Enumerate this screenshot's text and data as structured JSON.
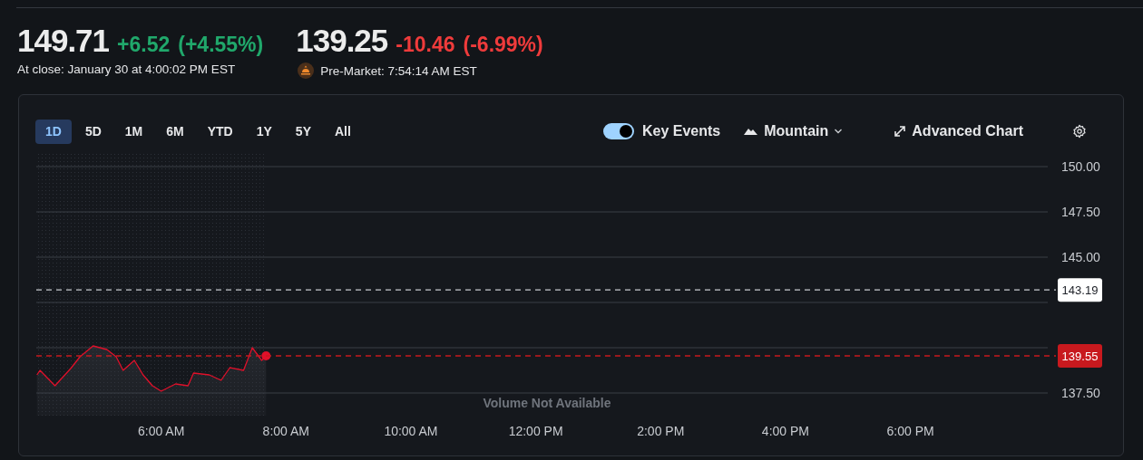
{
  "quote": {
    "price": "149.71",
    "change": "+6.52",
    "change_percent": "(+4.55%)",
    "close_label": "At close: January 30 at 4:00:02 PM EST"
  },
  "premarket": {
    "price": "139.25",
    "change": "-10.46",
    "change_percent": "(-6.99%)",
    "time_label": "Pre-Market: 7:54:14 AM EST"
  },
  "ranges": [
    {
      "label": "1D",
      "selected": true
    },
    {
      "label": "5D",
      "selected": false
    },
    {
      "label": "1M",
      "selected": false
    },
    {
      "label": "6M",
      "selected": false
    },
    {
      "label": "YTD",
      "selected": false
    },
    {
      "label": "1Y",
      "selected": false
    },
    {
      "label": "5Y",
      "selected": false
    },
    {
      "label": "All",
      "selected": false
    }
  ],
  "key_events": {
    "label": "Key Events",
    "on": true
  },
  "chart_type": {
    "label": "Mountain"
  },
  "advanced_chart": {
    "label": "Advanced Chart"
  },
  "volume_note": "Volume Not Available",
  "chart_data": {
    "type": "area",
    "grid": true,
    "x": [
      4.01,
      4.06,
      4.3,
      4.55,
      4.7,
      4.91,
      5.13,
      5.28,
      5.39,
      5.57,
      5.71,
      5.86,
      6.0,
      6.23,
      6.43,
      6.52,
      6.77,
      6.96,
      7.1,
      7.32,
      7.46,
      7.61,
      7.68
    ],
    "series": [
      {
        "color": "#e0102a",
        "values": [
          138.5,
          138.75,
          137.9,
          138.85,
          139.5,
          140.1,
          139.9,
          139.5,
          138.75,
          139.3,
          138.5,
          137.9,
          137.6,
          138.0,
          137.9,
          138.6,
          138.5,
          138.2,
          138.9,
          138.75,
          140.0,
          139.3,
          139.55
        ]
      }
    ],
    "xlim": [
      4,
      20.2
    ],
    "xticks": [
      {
        "value": 6,
        "label": "6:00 AM"
      },
      {
        "value": 8,
        "label": "8:00 AM"
      },
      {
        "value": 10,
        "label": "10:00 AM"
      },
      {
        "value": 12,
        "label": "12:00 PM"
      },
      {
        "value": 14,
        "label": "2:00 PM"
      },
      {
        "value": 16,
        "label": "4:00 PM"
      },
      {
        "value": 18,
        "label": "6:00 PM"
      }
    ],
    "yticks": [
      {
        "value": 137.5,
        "label": "137.50"
      },
      {
        "value": 145,
        "label": "145.00"
      },
      {
        "value": 147.5,
        "label": "147.50"
      },
      {
        "value": 150,
        "label": "150.00"
      }
    ],
    "ylim": [
      137.5,
      150
    ],
    "ref_lines": [
      {
        "axis": "y",
        "value": 143.19,
        "label": "143.19",
        "color": "#c9ccd1"
      },
      {
        "axis": "y",
        "value": 139.55,
        "label": "139.55",
        "color": "#c8191e"
      }
    ]
  }
}
